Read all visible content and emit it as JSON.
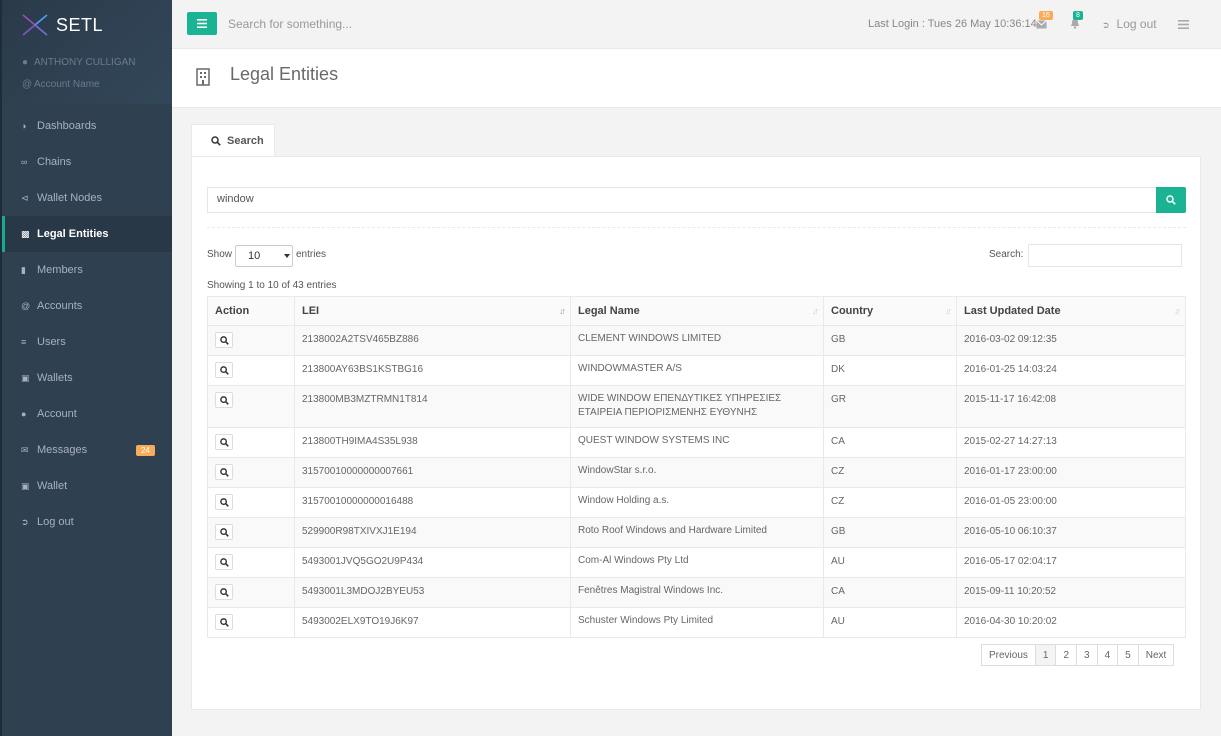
{
  "brand": {
    "name": "SETL"
  },
  "user": {
    "name": "ANTHONY CULLIGAN",
    "account": "Account Name"
  },
  "sidebar": {
    "items": [
      {
        "label": "Dashboards",
        "icon": "dashboard-icon"
      },
      {
        "label": "Chains",
        "icon": "link-icon"
      },
      {
        "label": "Wallet Nodes",
        "icon": "share-icon"
      },
      {
        "label": "Legal Entities",
        "icon": "building-icon",
        "active": true
      },
      {
        "label": "Members",
        "icon": "bookmark-icon"
      },
      {
        "label": "Accounts",
        "icon": "at-icon"
      },
      {
        "label": "Users",
        "icon": "database-icon"
      },
      {
        "label": "Wallets",
        "icon": "briefcase-icon"
      },
      {
        "label": "Account",
        "icon": "user-icon"
      },
      {
        "label": "Messages",
        "icon": "envelope-icon",
        "badge": "24"
      },
      {
        "label": "Wallet",
        "icon": "briefcase-icon"
      },
      {
        "label": "Log out",
        "icon": "sign-out-icon"
      }
    ]
  },
  "topbar": {
    "search_placeholder": "Search for something...",
    "last_login": "Last Login : Tues 26 May 10:36:14",
    "mail_badge": "16",
    "bell_badge": "8",
    "logout": "Log out"
  },
  "page": {
    "title": "Legal Entities"
  },
  "tabs": {
    "search": "Search"
  },
  "search": {
    "value": "window"
  },
  "datatable": {
    "show": "Show",
    "length": "10",
    "entries": "entries",
    "filter_label": "Search:",
    "info": "Showing 1 to 10 of 43 entries",
    "columns": [
      "Action",
      "LEI",
      "Legal Name",
      "Country",
      "Last Updated Date"
    ],
    "rows": [
      [
        "",
        "2138002A2TSV465BZ886",
        "CLEMENT WINDOWS LIMITED",
        "GB",
        "2016-03-02 09:12:35"
      ],
      [
        "",
        "213800AY63BS1KSTBG16",
        "WINDOWMASTER A/S",
        "DK",
        "2016-01-25 14:03:24"
      ],
      [
        "",
        "213800MB3MZTRMN1T814",
        "WIDE WINDOW ΕΠΕΝΔΥΤΙΚΕΣ ΥΠΗΡΕΣΙΕΣ ΕΤΑΙΡΕΙΑ ΠΕΡΙΟΡΙΣΜΕΝΗΣ ΕΥΘΥΝΗΣ",
        "GR",
        "2015-11-17 16:42:08"
      ],
      [
        "",
        "213800TH9IMA4S35L938",
        "QUEST WINDOW SYSTEMS INC",
        "CA",
        "2015-02-27 14:27:13"
      ],
      [
        "",
        "31570010000000007661",
        "WindowStar s.r.o.",
        "CZ",
        "2016-01-17 23:00:00"
      ],
      [
        "",
        "31570010000000016488",
        "Window Holding a.s.",
        "CZ",
        "2016-01-05 23:00:00"
      ],
      [
        "",
        "529900R98TXIVXJ1E194",
        "Roto Roof Windows and Hardware Limited",
        "GB",
        "2016-05-10 06:10:37"
      ],
      [
        "",
        "5493001JVQ5GO2U9P434",
        "Com-Al Windows Pty Ltd",
        "AU",
        "2016-05-17 02:04:17"
      ],
      [
        "",
        "5493001L3MDOJ2BYEU53",
        "Fenêtres Magistral Windows Inc.",
        "CA",
        "2015-09-11 10:20:52"
      ],
      [
        "",
        "5493002ELX9TO19J6K97",
        "Schuster Windows Pty Limited",
        "AU",
        "2016-04-30 10:20:02"
      ]
    ]
  },
  "pagination": {
    "previous": "Previous",
    "pages": [
      "1",
      "2",
      "3",
      "4",
      "5"
    ],
    "next": "Next"
  },
  "colors": {
    "accent": "#1ab394",
    "sidebar": "#2f4050",
    "badge_warning": "#f8ac59"
  }
}
